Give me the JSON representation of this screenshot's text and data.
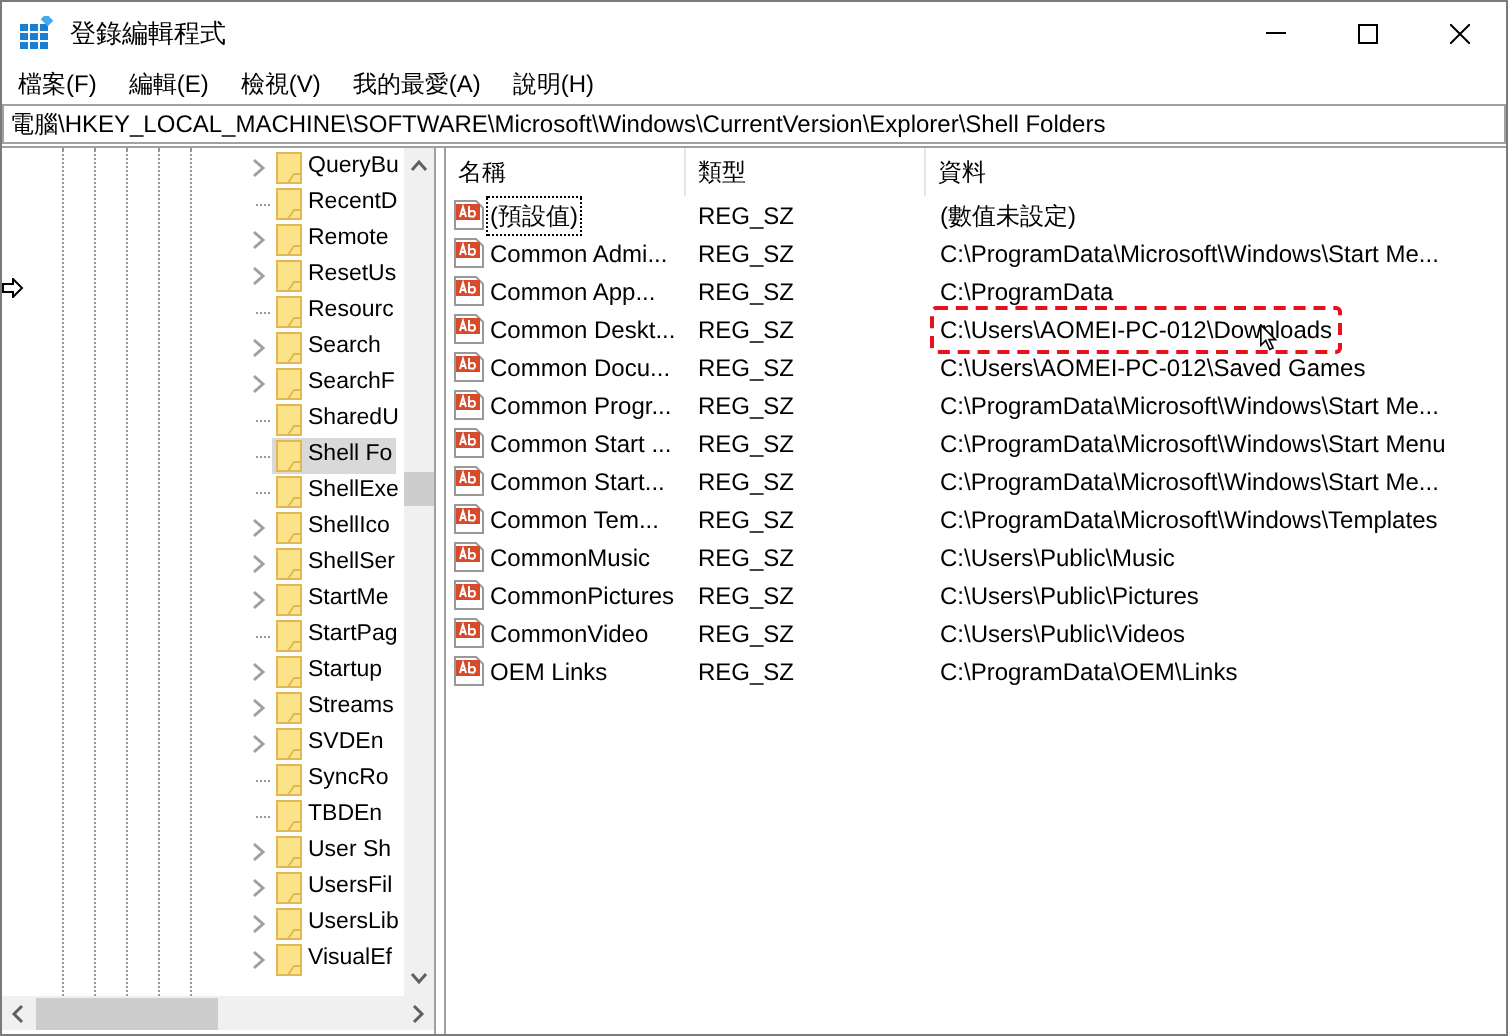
{
  "window": {
    "title": "登錄編輯程式"
  },
  "menu": [
    "檔案(F)",
    "編輯(E)",
    "檢視(V)",
    "我的最愛(A)",
    "說明(H)"
  ],
  "address": "電腦\\HKEY_LOCAL_MACHINE\\SOFTWARE\\Microsoft\\Windows\\CurrentVersion\\Explorer\\Shell Folders",
  "tree": {
    "items": [
      {
        "label": "QueryBu",
        "has_children": true,
        "selected": false
      },
      {
        "label": "RecentD",
        "has_children": false,
        "selected": false
      },
      {
        "label": "Remote",
        "has_children": true,
        "selected": false
      },
      {
        "label": "ResetUs",
        "has_children": true,
        "selected": false
      },
      {
        "label": "Resourc",
        "has_children": false,
        "selected": false
      },
      {
        "label": "Search",
        "has_children": true,
        "selected": false
      },
      {
        "label": "SearchF",
        "has_children": true,
        "selected": false
      },
      {
        "label": "SharedU",
        "has_children": false,
        "selected": false
      },
      {
        "label": "Shell Fo",
        "has_children": false,
        "selected": true
      },
      {
        "label": "ShellExe",
        "has_children": false,
        "selected": false
      },
      {
        "label": "ShellIco",
        "has_children": true,
        "selected": false
      },
      {
        "label": "ShellSer",
        "has_children": true,
        "selected": false
      },
      {
        "label": "StartMe",
        "has_children": true,
        "selected": false
      },
      {
        "label": "StartPag",
        "has_children": false,
        "selected": false
      },
      {
        "label": "Startup",
        "has_children": true,
        "selected": false
      },
      {
        "label": "Streams",
        "has_children": true,
        "selected": false
      },
      {
        "label": "SVDEn",
        "has_children": true,
        "selected": false
      },
      {
        "label": "SyncRo",
        "has_children": false,
        "selected": false
      },
      {
        "label": "TBDEn",
        "has_children": false,
        "selected": false
      },
      {
        "label": "User Sh",
        "has_children": true,
        "selected": false
      },
      {
        "label": "UsersFil",
        "has_children": true,
        "selected": false
      },
      {
        "label": "UsersLib",
        "has_children": true,
        "selected": false
      },
      {
        "label": "VisualEf",
        "has_children": true,
        "selected": false
      }
    ]
  },
  "table": {
    "columns": [
      "名稱",
      "類型",
      "資料"
    ],
    "rows": [
      {
        "name": "(預設值)",
        "type": "REG_SZ",
        "data": "(數值未設定)",
        "focused": true,
        "highlighted": false
      },
      {
        "name": "Common Admi...",
        "type": "REG_SZ",
        "data": "C:\\ProgramData\\Microsoft\\Windows\\Start Me...",
        "focused": false,
        "highlighted": false
      },
      {
        "name": "Common App...",
        "type": "REG_SZ",
        "data": "C:\\ProgramData",
        "focused": false,
        "highlighted": false
      },
      {
        "name": "Common Deskt...",
        "type": "REG_SZ",
        "data": "C:\\Users\\AOMEI-PC-012\\Downloads",
        "focused": false,
        "highlighted": true
      },
      {
        "name": "Common Docu...",
        "type": "REG_SZ",
        "data": "C:\\Users\\AOMEI-PC-012\\Saved Games",
        "focused": false,
        "highlighted": false
      },
      {
        "name": "Common Progr...",
        "type": "REG_SZ",
        "data": "C:\\ProgramData\\Microsoft\\Windows\\Start Me...",
        "focused": false,
        "highlighted": false
      },
      {
        "name": "Common Start ...",
        "type": "REG_SZ",
        "data": "C:\\ProgramData\\Microsoft\\Windows\\Start Menu",
        "focused": false,
        "highlighted": false
      },
      {
        "name": "Common Start...",
        "type": "REG_SZ",
        "data": "C:\\ProgramData\\Microsoft\\Windows\\Start Me...",
        "focused": false,
        "highlighted": false
      },
      {
        "name": "Common Tem...",
        "type": "REG_SZ",
        "data": "C:\\ProgramData\\Microsoft\\Windows\\Templates",
        "focused": false,
        "highlighted": false
      },
      {
        "name": "CommonMusic",
        "type": "REG_SZ",
        "data": "C:\\Users\\Public\\Music",
        "focused": false,
        "highlighted": false
      },
      {
        "name": "CommonPictures",
        "type": "REG_SZ",
        "data": "C:\\Users\\Public\\Pictures",
        "focused": false,
        "highlighted": false
      },
      {
        "name": "CommonVideo",
        "type": "REG_SZ",
        "data": "C:\\Users\\Public\\Videos",
        "focused": false,
        "highlighted": false
      },
      {
        "name": "OEM Links",
        "type": "REG_SZ",
        "data": "C:\\ProgramData\\OEM\\Links",
        "focused": false,
        "highlighted": false
      }
    ]
  }
}
